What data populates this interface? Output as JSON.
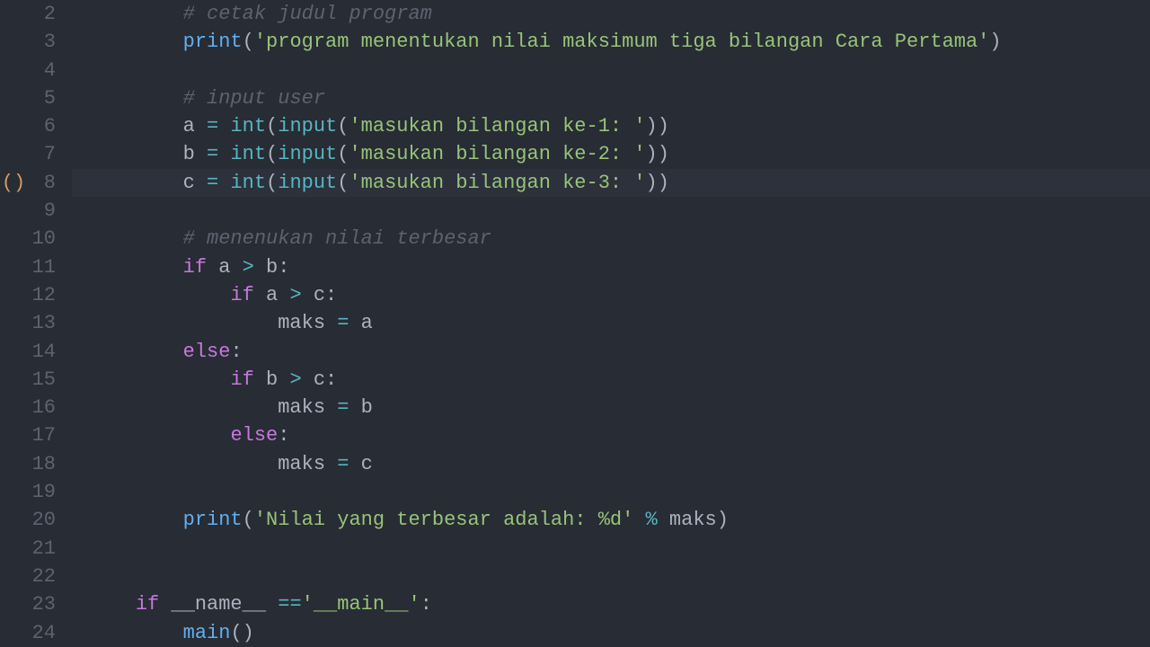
{
  "gutter_marker": "()",
  "lines": [
    {
      "n": 2,
      "hl": false,
      "indent": "        ",
      "tokens": [
        [
          "c-comment",
          "# cetak judul program"
        ]
      ]
    },
    {
      "n": 3,
      "hl": false,
      "indent": "        ",
      "tokens": [
        [
          "c-func",
          "print"
        ],
        [
          "c-default",
          "("
        ],
        [
          "c-str",
          "'program menentukan nilai maksimum tiga bilangan Cara Pertama'"
        ],
        [
          "c-default",
          ")"
        ]
      ]
    },
    {
      "n": 4,
      "hl": false,
      "indent": "",
      "tokens": []
    },
    {
      "n": 5,
      "hl": false,
      "indent": "        ",
      "tokens": [
        [
          "c-comment",
          "# input user"
        ]
      ]
    },
    {
      "n": 6,
      "hl": false,
      "indent": "        ",
      "tokens": [
        [
          "c-default",
          "a "
        ],
        [
          "c-op",
          "="
        ],
        [
          "c-default",
          " "
        ],
        [
          "c-builtin",
          "int"
        ],
        [
          "c-default",
          "("
        ],
        [
          "c-builtin",
          "input"
        ],
        [
          "c-default",
          "("
        ],
        [
          "c-str",
          "'masukan bilangan ke-1: '"
        ],
        [
          "c-default",
          "))"
        ]
      ]
    },
    {
      "n": 7,
      "hl": false,
      "indent": "        ",
      "tokens": [
        [
          "c-default",
          "b "
        ],
        [
          "c-op",
          "="
        ],
        [
          "c-default",
          " "
        ],
        [
          "c-builtin",
          "int"
        ],
        [
          "c-default",
          "("
        ],
        [
          "c-builtin",
          "input"
        ],
        [
          "c-default",
          "("
        ],
        [
          "c-str",
          "'masukan bilangan ke-2: '"
        ],
        [
          "c-default",
          "))"
        ]
      ]
    },
    {
      "n": 8,
      "hl": true,
      "indent": "        ",
      "tokens": [
        [
          "c-default",
          "c "
        ],
        [
          "c-op",
          "="
        ],
        [
          "c-default",
          " "
        ],
        [
          "c-builtin",
          "int"
        ],
        [
          "c-default",
          "("
        ],
        [
          "c-builtin",
          "input"
        ],
        [
          "c-default",
          "("
        ],
        [
          "c-str",
          "'masukan bilangan ke-3: '"
        ],
        [
          "c-default",
          "))"
        ]
      ]
    },
    {
      "n": 9,
      "hl": false,
      "indent": "",
      "tokens": []
    },
    {
      "n": 10,
      "hl": false,
      "indent": "        ",
      "tokens": [
        [
          "c-comment",
          "# menenukan nilai terbesar"
        ]
      ]
    },
    {
      "n": 11,
      "hl": false,
      "indent": "        ",
      "tokens": [
        [
          "c-kw",
          "if"
        ],
        [
          "c-default",
          " a "
        ],
        [
          "c-op",
          ">"
        ],
        [
          "c-default",
          " b:"
        ]
      ]
    },
    {
      "n": 12,
      "hl": false,
      "indent": "            ",
      "tokens": [
        [
          "c-kw",
          "if"
        ],
        [
          "c-default",
          " a "
        ],
        [
          "c-op",
          ">"
        ],
        [
          "c-default",
          " c:"
        ]
      ]
    },
    {
      "n": 13,
      "hl": false,
      "indent": "                ",
      "tokens": [
        [
          "c-default",
          "maks "
        ],
        [
          "c-op",
          "="
        ],
        [
          "c-default",
          " a"
        ]
      ]
    },
    {
      "n": 14,
      "hl": false,
      "indent": "        ",
      "tokens": [
        [
          "c-kw",
          "else"
        ],
        [
          "c-default",
          ":"
        ]
      ]
    },
    {
      "n": 15,
      "hl": false,
      "indent": "            ",
      "tokens": [
        [
          "c-kw",
          "if"
        ],
        [
          "c-default",
          " b "
        ],
        [
          "c-op",
          ">"
        ],
        [
          "c-default",
          " c:"
        ]
      ]
    },
    {
      "n": 16,
      "hl": false,
      "indent": "                ",
      "tokens": [
        [
          "c-default",
          "maks "
        ],
        [
          "c-op",
          "="
        ],
        [
          "c-default",
          " b"
        ]
      ]
    },
    {
      "n": 17,
      "hl": false,
      "indent": "            ",
      "tokens": [
        [
          "c-kw",
          "else"
        ],
        [
          "c-default",
          ":"
        ]
      ]
    },
    {
      "n": 18,
      "hl": false,
      "indent": "                ",
      "tokens": [
        [
          "c-default",
          "maks "
        ],
        [
          "c-op",
          "="
        ],
        [
          "c-default",
          " c"
        ]
      ]
    },
    {
      "n": 19,
      "hl": false,
      "indent": "",
      "tokens": []
    },
    {
      "n": 20,
      "hl": false,
      "indent": "        ",
      "tokens": [
        [
          "c-func",
          "print"
        ],
        [
          "c-default",
          "("
        ],
        [
          "c-str",
          "'Nilai yang terbesar adalah: %d'"
        ],
        [
          "c-default",
          " "
        ],
        [
          "c-op",
          "%"
        ],
        [
          "c-default",
          " maks)"
        ]
      ]
    },
    {
      "n": 21,
      "hl": false,
      "indent": "",
      "tokens": []
    },
    {
      "n": 22,
      "hl": false,
      "indent": "",
      "tokens": []
    },
    {
      "n": 23,
      "hl": false,
      "indent": "    ",
      "tokens": [
        [
          "c-kw",
          "if"
        ],
        [
          "c-default",
          " __name__ "
        ],
        [
          "c-op",
          "=="
        ],
        [
          "c-str",
          "'__main__'"
        ],
        [
          "c-default",
          ":"
        ]
      ]
    },
    {
      "n": 24,
      "hl": false,
      "indent": "        ",
      "tokens": [
        [
          "c-func",
          "main"
        ],
        [
          "c-default",
          "()"
        ]
      ]
    }
  ],
  "marker_line": 8
}
